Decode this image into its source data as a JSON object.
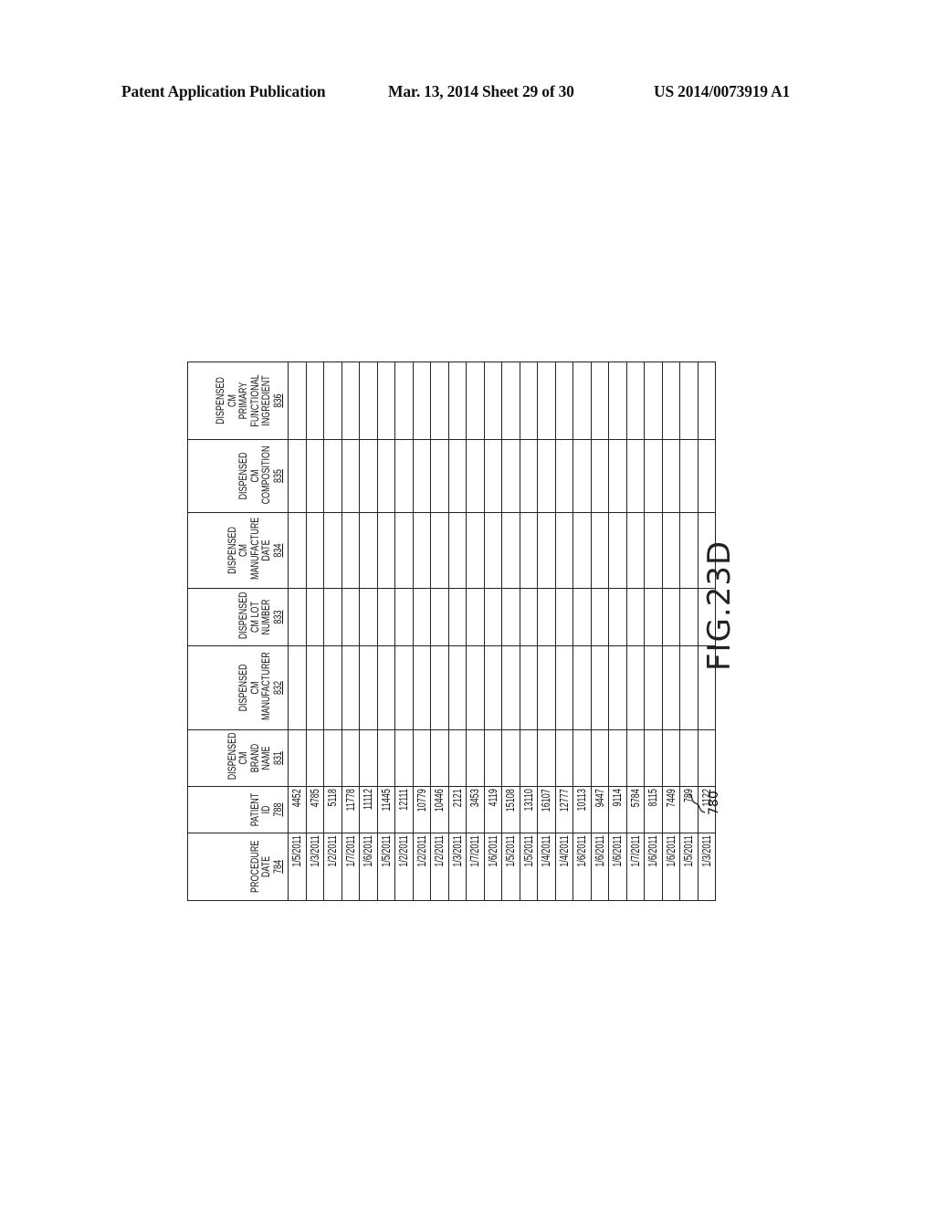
{
  "header": {
    "publication": "Patent Application Publication",
    "date_sheet": "Mar. 13, 2014  Sheet 29 of 30",
    "number": "US 2014/0073919 A1"
  },
  "figure": {
    "label": "FIG.23D",
    "reference": "780"
  },
  "table": {
    "columns": [
      {
        "label": "PROCEDURE\nDATE",
        "ref": "784"
      },
      {
        "label": "PATIENT\nID",
        "ref": "788"
      },
      {
        "label": "DISPENSED\nCM BRAND\nNAME",
        "ref": "831"
      },
      {
        "label": "DISPENSED\nCM\nMANUFACTURER",
        "ref": "832"
      },
      {
        "label": "DISPENSED\nCM LOT\nNUMBER",
        "ref": "833"
      },
      {
        "label": "DISPENSED CM\nMANUFACTURE\nDATE",
        "ref": "834"
      },
      {
        "label": "DISPENSED CM\nCOMPOSITION",
        "ref": "835"
      },
      {
        "label": "DISPENSED CM\nPRIMARY\nFUNCTIONAL\nINGREDIENT",
        "ref": "836"
      }
    ],
    "rows": [
      [
        "1/5/2011",
        "4452",
        "",
        "",
        "",
        "",
        "",
        ""
      ],
      [
        "1/3/2011",
        "4785",
        "",
        "",
        "",
        "",
        "",
        ""
      ],
      [
        "1/2/2011",
        "5118",
        "",
        "",
        "",
        "",
        "",
        ""
      ],
      [
        "1/7/2011",
        "11778",
        "",
        "",
        "",
        "",
        "",
        ""
      ],
      [
        "1/6/2011",
        "11112",
        "",
        "",
        "",
        "",
        "",
        ""
      ],
      [
        "1/5/2011",
        "11445",
        "",
        "",
        "",
        "",
        "",
        ""
      ],
      [
        "1/2/2011",
        "12111",
        "",
        "",
        "",
        "",
        "",
        ""
      ],
      [
        "1/2/2011",
        "10779",
        "",
        "",
        "",
        "",
        "",
        ""
      ],
      [
        "1/2/2011",
        "10446",
        "",
        "",
        "",
        "",
        "",
        ""
      ],
      [
        "1/3/2011",
        "2121",
        "",
        "",
        "",
        "",
        "",
        ""
      ],
      [
        "1/7/2011",
        "3453",
        "",
        "",
        "",
        "",
        "",
        ""
      ],
      [
        "1/6/2011",
        "4119",
        "",
        "",
        "",
        "",
        "",
        ""
      ],
      [
        "1/5/2011",
        "15108",
        "",
        "",
        "",
        "",
        "",
        ""
      ],
      [
        "1/5/2011",
        "13110",
        "",
        "",
        "",
        "",
        "",
        ""
      ],
      [
        "1/4/2011",
        "16107",
        "",
        "",
        "",
        "",
        "",
        ""
      ],
      [
        "1/4/2011",
        "12777",
        "",
        "",
        "",
        "",
        "",
        ""
      ],
      [
        "1/6/2011",
        "10113",
        "",
        "",
        "",
        "",
        "",
        ""
      ],
      [
        "1/6/2011",
        "9447",
        "",
        "",
        "",
        "",
        "",
        ""
      ],
      [
        "1/6/2011",
        "9114",
        "",
        "",
        "",
        "",
        "",
        ""
      ],
      [
        "1/7/2011",
        "5784",
        "",
        "",
        "",
        "",
        "",
        ""
      ],
      [
        "1/6/2011",
        "8115",
        "",
        "",
        "",
        "",
        "",
        ""
      ],
      [
        "1/6/2011",
        "7449",
        "",
        "",
        "",
        "",
        "",
        ""
      ],
      [
        "1/5/2011",
        "789",
        "",
        "",
        "",
        "",
        "",
        ""
      ],
      [
        "1/3/2011",
        "1122",
        "",
        "",
        "",
        "",
        "",
        ""
      ]
    ]
  }
}
